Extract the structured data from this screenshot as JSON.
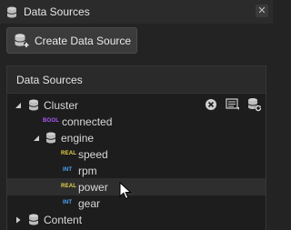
{
  "window": {
    "title": "Data Sources",
    "close_glyph": "✕"
  },
  "toolbar": {
    "create_label": "Create Data Source"
  },
  "panel": {
    "header": "Data Sources"
  },
  "tree": {
    "cluster": {
      "label": "Cluster"
    },
    "connected": {
      "type": "BOOL",
      "label": "connected"
    },
    "engine": {
      "label": "engine"
    },
    "speed": {
      "type": "REAL",
      "label": "speed"
    },
    "rpm": {
      "type": "INT",
      "label": "rpm"
    },
    "power": {
      "type": "REAL",
      "label": "power"
    },
    "gear": {
      "type": "INT",
      "label": "gear"
    },
    "content": {
      "label": "Content"
    }
  },
  "icons": {
    "title": "database-icon",
    "create": "add-database-icon",
    "clear": "clear-icon",
    "list": "list-icon",
    "refresh": "refresh-database-icon"
  },
  "colors": {
    "bool": "#b05cff",
    "real": "#e6d24a",
    "int": "#4aa8ff"
  }
}
